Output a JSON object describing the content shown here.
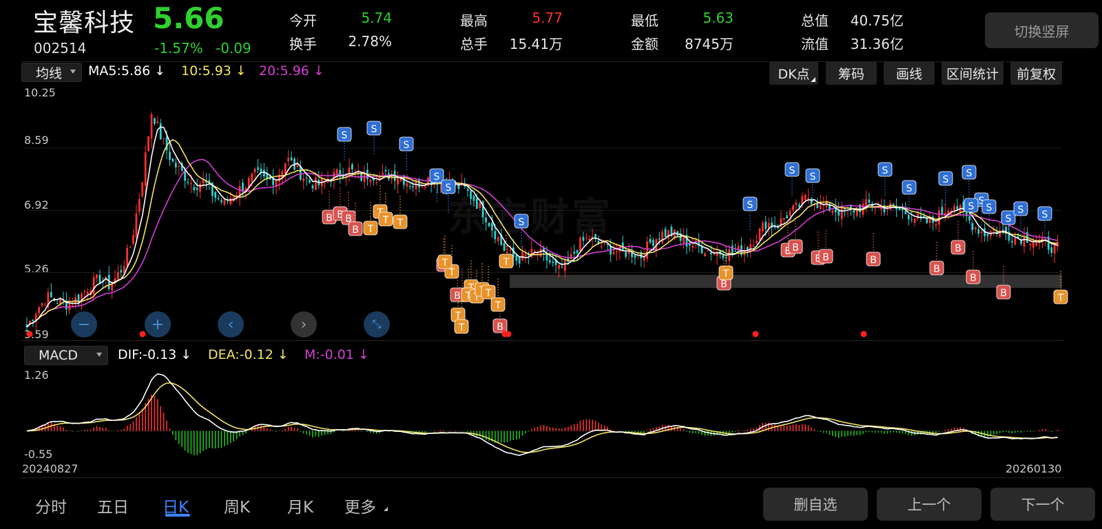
{
  "header": {
    "name": "宝馨科技",
    "code": "002514",
    "price": "5.66",
    "change_pct": "-1.57%",
    "change_amt": "-0.09",
    "open_label": "今开",
    "open_value": "5.74",
    "turnover_label": "换手",
    "turnover_value": "2.78%",
    "high_label": "最高",
    "high_value": "5.77",
    "volume_label": "总手",
    "volume_value": "15.41万",
    "low_label": "最低",
    "low_value": "5.63",
    "amount_label": "金额",
    "amount_value": "8745万",
    "mktcap_label": "总值",
    "mktcap_value": "40.75亿",
    "float_label": "流值",
    "float_value": "31.36亿",
    "portrait_button": "切换竖屏"
  },
  "main_chart": {
    "indicator_select": "均线",
    "ma5_label": "MA5:5.86",
    "ma10_label": "10:5.93",
    "ma20_label": "20:5.96",
    "ma5_color": "#ffffff",
    "ma10_color": "#f5e663",
    "ma20_color": "#d63fd6",
    "tools": [
      "DK点",
      "筹码",
      "画线",
      "区间统计",
      "前复权"
    ],
    "y_ticks": [
      "10.25",
      "8.59",
      "6.92",
      "5.26",
      "3.59"
    ],
    "watermark": "东方财富",
    "signal_labels": {
      "buy": "B",
      "sell": "S",
      "t": "T"
    }
  },
  "sub_chart": {
    "indicator_select": "MACD",
    "dif_label": "DIF:-0.13",
    "dea_label": "DEA:-0.12",
    "m_label": "M:-0.01",
    "dif_color": "#ffffff",
    "dea_color": "#f5e663",
    "m_color": "#d63fd6",
    "y_ticks": [
      "1.26",
      "-0.55"
    ]
  },
  "dates": {
    "start": "20240827",
    "end": "20260130"
  },
  "zoom_controls": [
    "zoom-out",
    "zoom-in",
    "scroll-left",
    "scroll-right",
    "reset"
  ],
  "bottom_tabs": [
    "分时",
    "五日",
    "日K",
    "周K",
    "月K",
    "更多"
  ],
  "active_tab": "日K",
  "actions": [
    "删自选",
    "上一个",
    "下一个"
  ],
  "colors": {
    "up": "#ff3030",
    "down": "#2fd0d0",
    "green_text": "#2fd02f",
    "accent": "#3a86ff"
  },
  "chart_data": {
    "type": "candlestick",
    "price_range": [
      3.59,
      10.25
    ],
    "macd_range": [
      -0.55,
      1.26
    ],
    "close_path": [
      3.8,
      4.3,
      4.6,
      4.5,
      4.4,
      4.6,
      4.9,
      5.1,
      4.9,
      5.3,
      6.0,
      7.6,
      9.6,
      8.8,
      8.2,
      7.9,
      7.6,
      7.7,
      7.3,
      7.1,
      7.4,
      7.6,
      7.9,
      7.7,
      7.8,
      8.3,
      8.0,
      7.7,
      7.6,
      7.8,
      7.9,
      8.0,
      7.8,
      7.9,
      7.8,
      7.9,
      7.8,
      7.6,
      7.7,
      7.8,
      7.7,
      7.6,
      7.5,
      7.2,
      6.8,
      6.3,
      5.8,
      5.6,
      5.7,
      5.8,
      5.6,
      5.3,
      5.5,
      6.0,
      6.2,
      6.0,
      5.9,
      5.8,
      5.8,
      5.7,
      6.1,
      6.3,
      6.3,
      6.1,
      6.0,
      5.9,
      5.8,
      5.8,
      5.8,
      5.9,
      6.2,
      6.6,
      6.5,
      6.8,
      7.0,
      7.3,
      7.1,
      7.0,
      6.9,
      6.9,
      7.0,
      7.1,
      7.0,
      7.0,
      6.9,
      6.8,
      6.6,
      6.6,
      6.9,
      7.1,
      6.8,
      6.5,
      6.3,
      6.4,
      6.3,
      6.2,
      6.2,
      6.1,
      6.0,
      5.9
    ],
    "buy_signals": 18,
    "sell_signals": 22,
    "t_signals": 24
  }
}
